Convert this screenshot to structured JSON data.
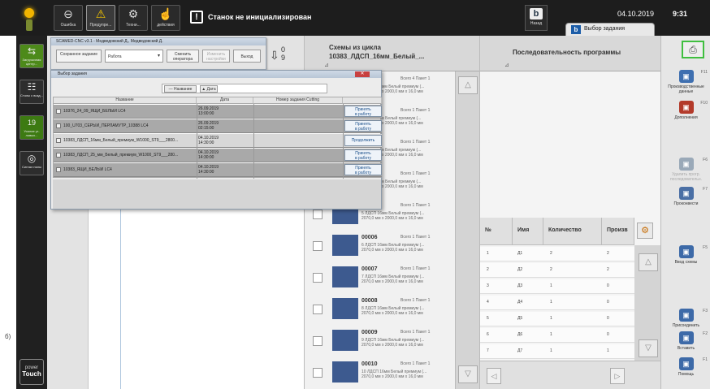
{
  "topbar": {
    "buttons": [
      {
        "label": "Ошибка",
        "icon": "error-icon"
      },
      {
        "label": "Предупре...",
        "icon": "warning-icon"
      },
      {
        "label": "Техни...",
        "icon": "maintenance-icon"
      },
      {
        "label": "действия",
        "icon": "actions-icon"
      }
    ],
    "warning_text": "Станок не инициализирован",
    "back_label": "Назад",
    "date": "04.10.2019",
    "time": "9:31",
    "mode_tab": "Выбор задания"
  },
  "sidebar": {
    "items": [
      {
        "label": "Загрузочная центр..."
      },
      {
        "label": "Столы с возд..."
      },
      {
        "label": "Усилие уг-ловых...",
        "value": "19"
      },
      {
        "label": "Сигнал пилы"
      }
    ],
    "power_line1": "power",
    "power_line2": "Touch"
  },
  "margin_mark": "б)",
  "middle": {
    "header_line1": "Схемы из цикла",
    "header_line2": "10383_ЛДСП_16мм_Белый_...",
    "corner_mark": "⊿",
    "rows": [
      {
        "num": "",
        "stats": "Всего 4     Пакет 1",
        "line1": "4  ЛДСП 16мм Белый премиум (...",
        "line2": "2070,0 мм x 2000,0 мм x 16,0 мм"
      },
      {
        "num": "",
        "stats": "Всего 1     Пакет 1",
        "line1": "ЛДСП 16мм Белый премиум (...",
        "line2": "2070,0 мм x 2000,0 мм x 16,0 мм"
      },
      {
        "num": "",
        "stats": "Всего 1     Пакет 1",
        "line1": "ЛДСП 16мм Белый премиум (...",
        "line2": "2070,0 мм x 2000,0 мм x 16,0 мм"
      },
      {
        "num": "",
        "stats": "Всего 1     Пакет 1",
        "line1": "ЛДСП 16мм Белый премиум (...",
        "line2": "2070,0 мм x 2000,0 мм x 16,0 мм"
      },
      {
        "num": "",
        "stats": "Всего 1     Пакет 1",
        "line1": "5  ЛДСП 16мм Белый премиум (...",
        "line2": "2070,0 мм x 2000,0 мм x 16,0 мм"
      },
      {
        "num": "00006",
        "stats": "Всего 1     Пакет 1",
        "line1": "6  ЛДСП 16мм Белый премиум (...",
        "line2": "2070,0 мм x 2000,0 мм x 16,0 мм"
      },
      {
        "num": "00007",
        "stats": "Всего 1     Пакет 1",
        "line1": "7  ЛДСП 16мм Белый премиум (...",
        "line2": "2070,0 мм x 2000,0 мм x 16,0 мм"
      },
      {
        "num": "00008",
        "stats": "Всего 1     Пакет 1",
        "line1": "8  ЛДСП 16мм Белый премиум (...",
        "line2": "2070,0 мм x 2000,0 мм x 16,0 мм"
      },
      {
        "num": "00009",
        "stats": "Всего 1     Пакет 1",
        "line1": "9  ЛДСП 16мм Белый премиум (...",
        "line2": "2070,0 мм x 2000,0 мм x 16,0 мм"
      },
      {
        "num": "00010",
        "stats": "Всего 1     Пакет 1",
        "line1": "10 ЛДСП 16мм Белый премиум (...",
        "line2": "2070,0 мм x 2000,0 мм x 16,0 мм"
      }
    ]
  },
  "right": {
    "header": "Последовательность программы",
    "corner_mark": "⊿",
    "columns": [
      "№",
      "Имя",
      "Количество",
      "Произв"
    ],
    "rows": [
      [
        "1",
        "Д1",
        "2",
        "2"
      ],
      [
        "2",
        "Д2",
        "2",
        "2"
      ],
      [
        "3",
        "Д3",
        "1",
        "0"
      ],
      [
        "4",
        "Д4",
        "1",
        "0"
      ],
      [
        "5",
        "Д5",
        "1",
        "0"
      ],
      [
        "6",
        "Д6",
        "1",
        "0"
      ],
      [
        "7",
        "Д7",
        "1",
        "1"
      ]
    ]
  },
  "toolbar": {
    "items": [
      {
        "fkey": "F11",
        "label": "Производственные данные",
        "color": "#3e6fb0",
        "dim": false
      },
      {
        "fkey": "F10",
        "label": "Дополнения",
        "color": "#b33a2a",
        "dim": false
      },
      {
        "fkey": "F6",
        "label": "Удалить прогр. последовательн.",
        "color": "#9aa9b8",
        "dim": true
      },
      {
        "fkey": "F7",
        "label": "Проконвести",
        "color": "#4a6fa5",
        "dim": false
      },
      {
        "fkey": "F5",
        "label": "Ввод схемы",
        "color": "#3d6aa8",
        "dim": false
      },
      {
        "fkey": "F3",
        "label": "Присоединить",
        "color": "#3d6aa8",
        "dim": false
      },
      {
        "fkey": "F2",
        "label": "Вставить",
        "color": "#3d6aa8",
        "dim": false
      },
      {
        "fkey": "F1",
        "label": "Помощь",
        "color": "#3d6aa8",
        "dim": false
      }
    ]
  },
  "dialog1": {
    "title": "SCAMED-CNC v3.1 - Медведовский Д., Медведовский Д.",
    "btn_new": "Сохранное задание",
    "work_label": "Работа",
    "btn_operator": "Сменить оператора",
    "btn_settings": "Изменить настройки",
    "btn_exit": "Выход",
    "counter_top": "0",
    "counter_bottom": "9"
  },
  "dialog2": {
    "title": "Выбор задания",
    "sort_name": "— Название",
    "sort_date": "▲ Дата",
    "columns": [
      "Название",
      "Дата",
      "Номер задания Cutting"
    ],
    "rows": [
      {
        "name": "10376_24_09_ЯЩИ_БЕЛЫЙ LC4",
        "date1": "26.09.2019",
        "date2": "13:00:00",
        "action1": "Принять",
        "action2": "в работу",
        "style": "g"
      },
      {
        "name": "100_U703_СЕРЫЙ_ПЕРЛАМУТР_10388 LC4",
        "date1": "26.09.2019",
        "date2": "02:15:00",
        "action1": "Принять",
        "action2": "в работу",
        "style": "g"
      },
      {
        "name": "10383_ЛДСП_16мм_Белый_премиум_W1000_ST9___2800...",
        "date1": "04.10.2019",
        "date2": "14:30:00",
        "action1": "Продолжить",
        "action2": "",
        "style": "w"
      },
      {
        "name": "10383_ЛДСП_25_мм_Белый_премиум_W1000_ST9___280...",
        "date1": "04.10.2019",
        "date2": "14:30:00",
        "action1": "Принять",
        "action2": "в работу",
        "style": "g"
      },
      {
        "name": "10383_ЯЩИ_БЕЛЫЙ LC4",
        "date1": "04.10.2019",
        "date2": "14:30:00",
        "action1": "Принять",
        "action2": "в работу",
        "style": "g"
      }
    ]
  }
}
